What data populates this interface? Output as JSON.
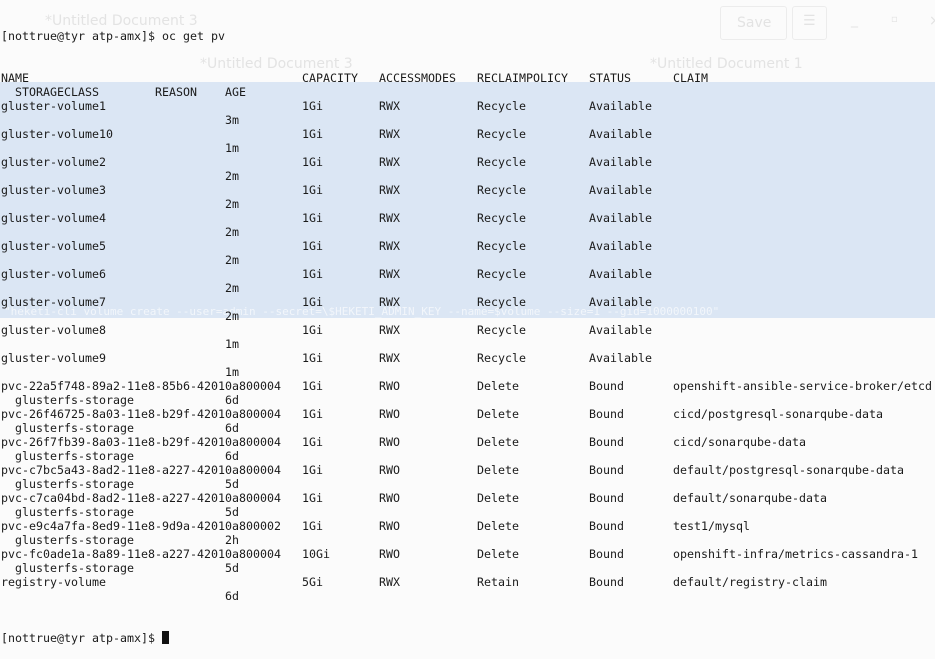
{
  "ghost_editor": {
    "tab_title_1": "*Untitled Document 3",
    "tab_title_2": "*Untitled Document 3",
    "tab_title_3": "*Untitled Document 1",
    "save_label": "Save",
    "menu_icon": "hamburger-icon",
    "minimize_icon": "minimize-icon",
    "maximize_icon": "maximize-icon",
    "close_icon": "close-icon",
    "command_text": "\"heketi-cli volume create --user=admin --secret=\\$HEKETI_ADMIN_KEY --name=$volume --size=1 --gid=1000000100\""
  },
  "terminal": {
    "prompt": "[nottrue@tyr atp-amx]$ ",
    "command": "oc get pv",
    "headers": {
      "name": "NAME",
      "capacity": "CAPACITY",
      "accessmodes": "ACCESSMODES",
      "reclaimpolicy": "RECLAIMPOLICY",
      "status": "STATUS",
      "claim": "CLAIM",
      "storageclass": "STORAGECLASS",
      "reason": "REASON",
      "age": "AGE"
    },
    "rows": [
      {
        "name": "gluster-volume1",
        "capacity": "1Gi",
        "access": "RWX",
        "reclaim": "Recycle",
        "status": "Available",
        "claim": "",
        "storageclass": "",
        "reason": "",
        "age": "3m"
      },
      {
        "name": "gluster-volume10",
        "capacity": "1Gi",
        "access": "RWX",
        "reclaim": "Recycle",
        "status": "Available",
        "claim": "",
        "storageclass": "",
        "reason": "",
        "age": "1m"
      },
      {
        "name": "gluster-volume2",
        "capacity": "1Gi",
        "access": "RWX",
        "reclaim": "Recycle",
        "status": "Available",
        "claim": "",
        "storageclass": "",
        "reason": "",
        "age": "2m"
      },
      {
        "name": "gluster-volume3",
        "capacity": "1Gi",
        "access": "RWX",
        "reclaim": "Recycle",
        "status": "Available",
        "claim": "",
        "storageclass": "",
        "reason": "",
        "age": "2m"
      },
      {
        "name": "gluster-volume4",
        "capacity": "1Gi",
        "access": "RWX",
        "reclaim": "Recycle",
        "status": "Available",
        "claim": "",
        "storageclass": "",
        "reason": "",
        "age": "2m"
      },
      {
        "name": "gluster-volume5",
        "capacity": "1Gi",
        "access": "RWX",
        "reclaim": "Recycle",
        "status": "Available",
        "claim": "",
        "storageclass": "",
        "reason": "",
        "age": "2m"
      },
      {
        "name": "gluster-volume6",
        "capacity": "1Gi",
        "access": "RWX",
        "reclaim": "Recycle",
        "status": "Available",
        "claim": "",
        "storageclass": "",
        "reason": "",
        "age": "2m"
      },
      {
        "name": "gluster-volume7",
        "capacity": "1Gi",
        "access": "RWX",
        "reclaim": "Recycle",
        "status": "Available",
        "claim": "",
        "storageclass": "",
        "reason": "",
        "age": "2m"
      },
      {
        "name": "gluster-volume8",
        "capacity": "1Gi",
        "access": "RWX",
        "reclaim": "Recycle",
        "status": "Available",
        "claim": "",
        "storageclass": "",
        "reason": "",
        "age": "1m"
      },
      {
        "name": "gluster-volume9",
        "capacity": "1Gi",
        "access": "RWX",
        "reclaim": "Recycle",
        "status": "Available",
        "claim": "",
        "storageclass": "",
        "reason": "",
        "age": "1m"
      },
      {
        "name": "pvc-22a5f748-89a2-11e8-85b6-42010a800004",
        "capacity": "1Gi",
        "access": "RWO",
        "reclaim": "Delete",
        "status": "Bound",
        "claim": "openshift-ansible-service-broker/etcd",
        "storageclass": "glusterfs-storage",
        "reason": "",
        "age": "6d"
      },
      {
        "name": "pvc-26f46725-8a03-11e8-b29f-42010a800004",
        "capacity": "1Gi",
        "access": "RWO",
        "reclaim": "Delete",
        "status": "Bound",
        "claim": "cicd/postgresql-sonarqube-data",
        "storageclass": "glusterfs-storage",
        "reason": "",
        "age": "6d"
      },
      {
        "name": "pvc-26f7fb39-8a03-11e8-b29f-42010a800004",
        "capacity": "1Gi",
        "access": "RWO",
        "reclaim": "Delete",
        "status": "Bound",
        "claim": "cicd/sonarqube-data",
        "storageclass": "glusterfs-storage",
        "reason": "",
        "age": "6d"
      },
      {
        "name": "pvc-c7bc5a43-8ad2-11e8-a227-42010a800004",
        "capacity": "1Gi",
        "access": "RWO",
        "reclaim": "Delete",
        "status": "Bound",
        "claim": "default/postgresql-sonarqube-data",
        "storageclass": "glusterfs-storage",
        "reason": "",
        "age": "5d"
      },
      {
        "name": "pvc-c7ca04bd-8ad2-11e8-a227-42010a800004",
        "capacity": "1Gi",
        "access": "RWO",
        "reclaim": "Delete",
        "status": "Bound",
        "claim": "default/sonarqube-data",
        "storageclass": "glusterfs-storage",
        "reason": "",
        "age": "5d"
      },
      {
        "name": "pvc-e9c4a7fa-8ed9-11e8-9d9a-42010a800002",
        "capacity": "1Gi",
        "access": "RWO",
        "reclaim": "Delete",
        "status": "Bound",
        "claim": "test1/mysql",
        "storageclass": "glusterfs-storage",
        "reason": "",
        "age": "2h"
      },
      {
        "name": "pvc-fc0ade1a-8a89-11e8-a227-42010a800004",
        "capacity": "10Gi",
        "access": "RWO",
        "reclaim": "Delete",
        "status": "Bound",
        "claim": "openshift-infra/metrics-cassandra-1",
        "storageclass": "glusterfs-storage",
        "reason": "",
        "age": "5d"
      },
      {
        "name": "registry-volume",
        "capacity": "5Gi",
        "access": "RWX",
        "reclaim": "Retain",
        "status": "Bound",
        "claim": "default/registry-claim",
        "storageclass": "",
        "reason": "",
        "age": "6d"
      }
    ],
    "final_prompt": "[nottrue@tyr atp-amx]$ "
  }
}
